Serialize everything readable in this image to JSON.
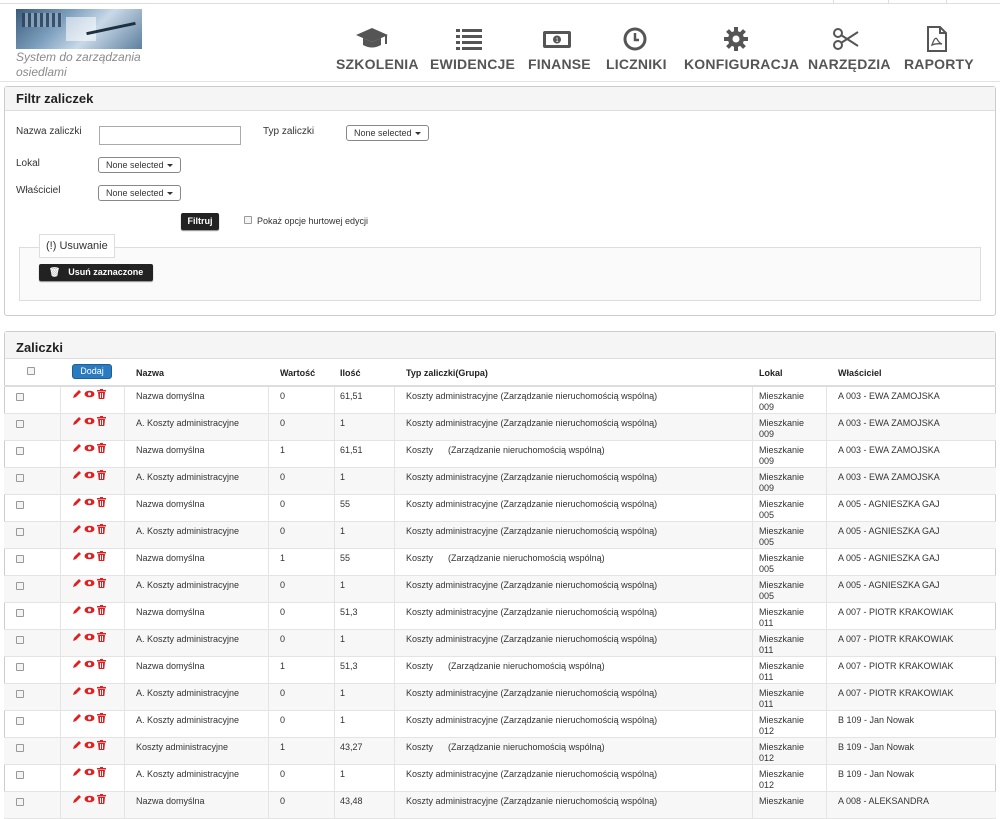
{
  "app": {
    "subtitle": "System do zarządzania osiedlami"
  },
  "nav": [
    {
      "label": "SZKOLENIA",
      "icon": "graduation-cap-icon"
    },
    {
      "label": "EWIDENCJE",
      "icon": "list-icon"
    },
    {
      "label": "FINANSE",
      "icon": "money-icon"
    },
    {
      "label": "LICZNIKI",
      "icon": "clock-icon"
    },
    {
      "label": "KONFIGURACJA",
      "icon": "gear-icon"
    },
    {
      "label": "NARZĘDZIA",
      "icon": "scissors-icon"
    },
    {
      "label": "RAPORTY",
      "icon": "pdf-file-icon"
    }
  ],
  "filter": {
    "title": "Filtr zaliczek",
    "name_label": "Nazwa zaliczki",
    "name_value": "",
    "type_label": "Typ zaliczki",
    "type_value": "None selected",
    "lokal_label": "Lokal",
    "lokal_value": "None selected",
    "owner_label": "Właściciel",
    "owner_value": "None selected",
    "filter_button": "Filtruj",
    "bulk_label": "Pokaż opcje hurtowej edycji",
    "delete_legend": "(!) Usuwanie",
    "delete_button": "Usuń zaznaczone"
  },
  "table": {
    "title": "Zaliczki",
    "add_button": "Dodaj",
    "columns": [
      "Nazwa",
      "Wartość",
      "Ilość",
      "Typ zaliczki(Grupa)",
      "Lokal",
      "Właściciel"
    ],
    "rows": [
      {
        "nazwa": "Nazwa domyślna",
        "wartosc": "0",
        "ilosc": "61,51",
        "typ": "Koszty administracyjne (Zarządzanie nieruchomością wspólną)",
        "lokal1": "Mieszkanie",
        "lokal2": "009",
        "wlasciciel": "A 003 - EWA ZAMOJSKA"
      },
      {
        "nazwa": "A. Koszty administracyjne",
        "wartosc": "0",
        "ilosc": "1",
        "typ": "Koszty administracyjne (Zarządzanie nieruchomością wspólną)",
        "lokal1": "Mieszkanie",
        "lokal2": "009",
        "wlasciciel": "A 003 - EWA ZAMOJSKA"
      },
      {
        "nazwa": "Nazwa domyślna",
        "wartosc": "1",
        "ilosc": "61,51",
        "typ": "Koszty      (Zarządzanie nieruchomością wspólną)",
        "lokal1": "Mieszkanie",
        "lokal2": "009",
        "wlasciciel": "A 003 - EWA ZAMOJSKA"
      },
      {
        "nazwa": "A. Koszty administracyjne",
        "wartosc": "0",
        "ilosc": "1",
        "typ": "Koszty administracyjne (Zarządzanie nieruchomością wspólną)",
        "lokal1": "Mieszkanie",
        "lokal2": "009",
        "wlasciciel": "A 003 - EWA ZAMOJSKA"
      },
      {
        "nazwa": "Nazwa domyślna",
        "wartosc": "0",
        "ilosc": "55",
        "typ": "Koszty administracyjne (Zarządzanie nieruchomością wspólną)",
        "lokal1": "Mieszkanie",
        "lokal2": "005",
        "wlasciciel": "A 005 - AGNIESZKA GAJ"
      },
      {
        "nazwa": "A. Koszty administracyjne",
        "wartosc": "0",
        "ilosc": "1",
        "typ": "Koszty administracyjne (Zarządzanie nieruchomością wspólną)",
        "lokal1": "Mieszkanie",
        "lokal2": "005",
        "wlasciciel": "A 005 - AGNIESZKA GAJ"
      },
      {
        "nazwa": "Nazwa domyślna",
        "wartosc": "1",
        "ilosc": "55",
        "typ": "Koszty      (Zarządzanie nieruchomością wspólną)",
        "lokal1": "Mieszkanie",
        "lokal2": "005",
        "wlasciciel": "A 005 - AGNIESZKA GAJ"
      },
      {
        "nazwa": "A. Koszty administracyjne",
        "wartosc": "0",
        "ilosc": "1",
        "typ": "Koszty administracyjne (Zarządzanie nieruchomością wspólną)",
        "lokal1": "Mieszkanie",
        "lokal2": "005",
        "wlasciciel": "A 005 - AGNIESZKA GAJ"
      },
      {
        "nazwa": "Nazwa domyślna",
        "wartosc": "0",
        "ilosc": "51,3",
        "typ": "Koszty administracyjne (Zarządzanie nieruchomością wspólną)",
        "lokal1": "Mieszkanie",
        "lokal2": "011",
        "wlasciciel": "A 007 - PIOTR KRAKOWIAK"
      },
      {
        "nazwa": "A. Koszty administracyjne",
        "wartosc": "0",
        "ilosc": "1",
        "typ": "Koszty administracyjne (Zarządzanie nieruchomością wspólną)",
        "lokal1": "Mieszkanie",
        "lokal2": "011",
        "wlasciciel": "A 007 - PIOTR KRAKOWIAK"
      },
      {
        "nazwa": "Nazwa domyślna",
        "wartosc": "1",
        "ilosc": "51,3",
        "typ": "Koszty      (Zarządzanie nieruchomością wspólną)",
        "lokal1": "Mieszkanie",
        "lokal2": "011",
        "wlasciciel": "A 007 - PIOTR KRAKOWIAK"
      },
      {
        "nazwa": "A. Koszty administracyjne",
        "wartosc": "0",
        "ilosc": "1",
        "typ": "Koszty administracyjne (Zarządzanie nieruchomością wspólną)",
        "lokal1": "Mieszkanie",
        "lokal2": "011",
        "wlasciciel": "A 007 - PIOTR KRAKOWIAK"
      },
      {
        "nazwa": "A. Koszty administracyjne",
        "wartosc": "0",
        "ilosc": "1",
        "typ": "Koszty administracyjne (Zarządzanie nieruchomością wspólną)",
        "lokal1": "Mieszkanie",
        "lokal2": "012",
        "wlasciciel": "B 109 - Jan Nowak"
      },
      {
        "nazwa": "Koszty administracyjne",
        "wartosc": "1",
        "ilosc": "43,27",
        "typ": "Koszty      (Zarządzanie nieruchomością wspólną)",
        "lokal1": "Mieszkanie",
        "lokal2": "012",
        "wlasciciel": "B 109 - Jan Nowak"
      },
      {
        "nazwa": "A. Koszty administracyjne",
        "wartosc": "0",
        "ilosc": "1",
        "typ": "Koszty administracyjne (Zarządzanie nieruchomością wspólną)",
        "lokal1": "Mieszkanie",
        "lokal2": "012",
        "wlasciciel": "B 109 - Jan Nowak"
      },
      {
        "nazwa": "Nazwa domyślna",
        "wartosc": "0",
        "ilosc": "43,48",
        "typ": "Koszty administracyjne (Zarządzanie nieruchomością wspólną)",
        "lokal1": "Mieszkanie",
        "lokal2": "",
        "wlasciciel": "A 008 - ALEKSANDRA"
      }
    ]
  },
  "colors": {
    "primary_button": "#2a7bc0",
    "dark_button": "#222222",
    "action_icons": "#e02020"
  }
}
